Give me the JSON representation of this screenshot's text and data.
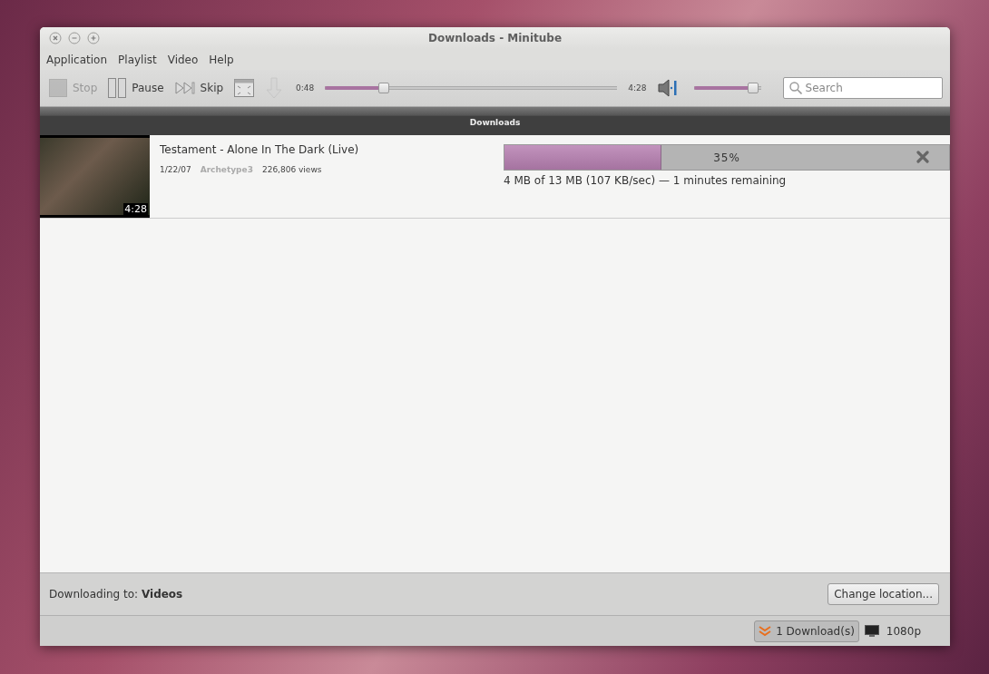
{
  "window": {
    "title": "Downloads - Minitube"
  },
  "menu": [
    {
      "label": "Application"
    },
    {
      "label": "Playlist"
    },
    {
      "label": "Video"
    },
    {
      "label": "Help"
    }
  ],
  "toolbar": {
    "buttons": [
      {
        "kind": "stop",
        "label": "Stop",
        "disabled": true
      },
      {
        "kind": "pause",
        "label": "Pause",
        "disabled": false
      },
      {
        "kind": "skip",
        "label": "Skip",
        "disabled": false
      },
      {
        "kind": "fullscreen",
        "disabled": false
      },
      {
        "kind": "download",
        "disabled": true
      }
    ],
    "elapsed": "0:48",
    "seek": {
      "level": 0.19
    },
    "total": "4:28",
    "volume": {
      "level": 0.96
    },
    "search": {
      "placeholder": "Search"
    }
  },
  "header": "Downloads",
  "downloads": [
    {
      "title": "Testament - Alone In The Dark (Live)",
      "date": "1/22/07",
      "author": "Archetype3",
      "views": "226,806 views",
      "duration": "4:28",
      "level": 0.35,
      "percent": "35%",
      "info": "4 MB of 13 MB (107 KB/sec) — 1 minutes remaining"
    }
  ],
  "footer": {
    "location": "Downloading to: **Videos**",
    "button": "Change location..."
  },
  "status_bar": {
    "downloads_button": "1 Download(s)",
    "quality": "1080p"
  }
}
